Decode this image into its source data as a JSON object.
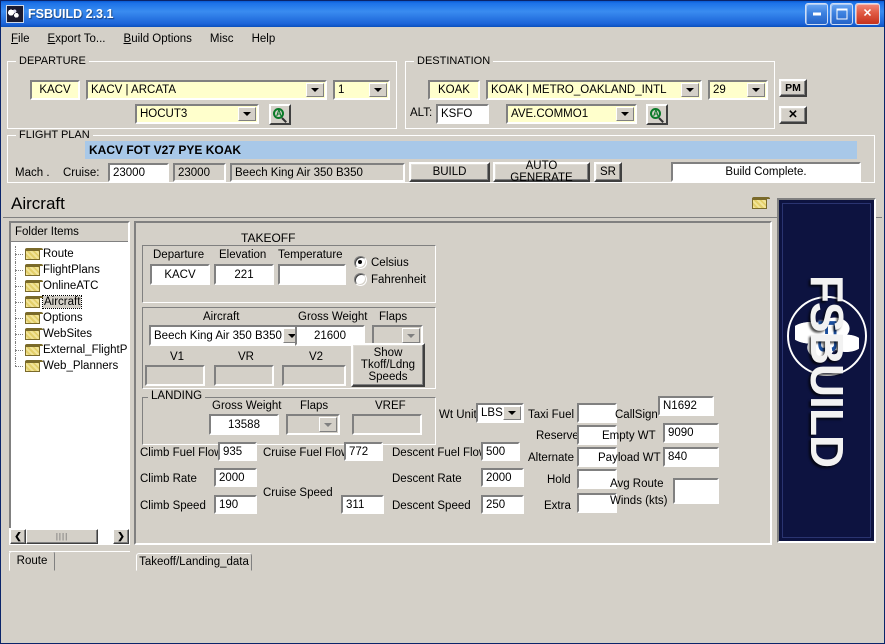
{
  "window": {
    "title": "FSBUILD 2.3.1",
    "icon": "app-icon",
    "buttons": {
      "minimize": "minimize",
      "maximize": "maximize",
      "close": "close"
    }
  },
  "menu": [
    {
      "label": "File",
      "accel": "F"
    },
    {
      "label": "Export To...",
      "accel": "E"
    },
    {
      "label": "Build Options",
      "accel": "B"
    },
    {
      "label": "Misc",
      "accel": ""
    },
    {
      "label": "Help",
      "accel": ""
    }
  ],
  "departure": {
    "legend": "DEPARTURE",
    "icao": "KACV",
    "airport": "KACV | ARCATA",
    "runway": "1",
    "procedure": "HOCUT3",
    "search_icon": "magnifier-icon"
  },
  "destination": {
    "legend": "DESTINATION",
    "icao": "KOAK",
    "airport": "KOAK | METRO_OAKLAND_INTL",
    "runway": "29",
    "alt_label": "ALT:",
    "alt_icao": "KSFO",
    "procedure": "AVE.COMMO1",
    "search_icon": "magnifier-icon",
    "pm_button": "PM",
    "close_button": "✕"
  },
  "flight_plan": {
    "legend": "FLIGHT PLAN",
    "route": "KACV FOT V27 PYE KOAK",
    "mach_label": "Mach .",
    "cruise_label": "Cruise:",
    "cruise_1": "23000",
    "cruise_2": "23000",
    "aircraft": "Beech King Air 350 B350",
    "build_button": "BUILD",
    "auto_generate_button": "AUTO GENERATE",
    "sr_button": "SR",
    "status": "Build Complete."
  },
  "section": {
    "title": "Aircraft",
    "folder_icon": "folder-icon"
  },
  "tree": {
    "header": "Folder Items",
    "close_icon": "close-icon",
    "items": [
      {
        "label": "Route",
        "selected": false
      },
      {
        "label": "FlightPlans",
        "selected": false
      },
      {
        "label": "OnlineATC",
        "selected": false
      },
      {
        "label": "Aircraft",
        "selected": true
      },
      {
        "label": "Options",
        "selected": false
      },
      {
        "label": "WebSites",
        "selected": false
      },
      {
        "label": "External_FlightP",
        "selected": false
      },
      {
        "label": "Web_Planners",
        "selected": false
      }
    ],
    "scroll_left": "❮",
    "scroll_right": "❯",
    "tab": "Route"
  },
  "takeoff": {
    "legend": "TAKEOFF",
    "departure_label": "Departure",
    "departure_value": "KACV",
    "elevation_label": "Elevation",
    "elevation_value": "221",
    "temperature_label": "Temperature",
    "temperature_value": "",
    "celsius_label": "Celsius",
    "fahrenheit_label": "Fahrenheit",
    "temp_unit_selected": "Celsius"
  },
  "aircraft_group": {
    "aircraft_label": "Aircraft",
    "aircraft_value": "Beech King Air 350 B350",
    "gross_weight_label": "Gross Weight",
    "gross_weight_value": "21600",
    "flaps_label": "Flaps",
    "flaps_value": "",
    "v1_label": "V1",
    "v1_value": "",
    "vr_label": "VR",
    "vr_value": "",
    "v2_label": "V2",
    "v2_value": "",
    "show_speeds_button": "Show\nTkoff/Ldng\nSpeeds",
    "show_speeds_line1": "Show",
    "show_speeds_line2": "Tkoff/Ldng",
    "show_speeds_line3": "Speeds"
  },
  "landing": {
    "legend": "LANDING",
    "gross_weight_label": "Gross Weight",
    "gross_weight_value": "13588",
    "flaps_label": "Flaps",
    "flaps_value": "",
    "vref_label": "VREF",
    "vref_value": ""
  },
  "performance": {
    "climb_fuel_flow_label": "Climb Fuel Flow",
    "climb_fuel_flow_value": "935",
    "climb_rate_label": "Climb Rate",
    "climb_rate_value": "2000",
    "climb_speed_label": "Climb Speed",
    "climb_speed_value": "190",
    "cruise_fuel_flow_label": "Cruise Fuel Flow",
    "cruise_fuel_flow_value": "772",
    "cruise_speed_label": "Cruise Speed",
    "cruise_speed_value": "311",
    "descent_fuel_flow_label": "Descent Fuel Flow",
    "descent_fuel_flow_value": "500",
    "descent_rate_label": "Descent Rate",
    "descent_rate_value": "2000",
    "descent_speed_label": "Descent Speed",
    "descent_speed_value": "250"
  },
  "fuel": {
    "wt_unit_label": "Wt Unit",
    "wt_unit_value": "LBS",
    "taxi_fuel_label": "Taxi Fuel",
    "taxi_fuel_value": "",
    "reserve_label": "Reserve",
    "reserve_value": "",
    "alternate_label": "Alternate",
    "alternate_value": "",
    "hold_label": "Hold",
    "hold_value": "",
    "extra_label": "Extra",
    "extra_value": ""
  },
  "weights": {
    "callsign_label": "CallSign",
    "callsign_value": "N1692",
    "empty_wt_label": "Empty WT",
    "empty_wt_value": "9090",
    "payload_wt_label": "Payload WT",
    "payload_wt_value": "840",
    "avg_winds_label_1": "Avg Route",
    "avg_winds_label_2": "Winds (kts)",
    "avg_winds_value": ""
  },
  "bottom_tab": {
    "label": "Takeoff/Landing_data"
  },
  "logo": {
    "word": "FSBUILD",
    "mark": "FS"
  },
  "colors": {
    "titlebar_blue": "#1c72e8",
    "face": "#d4d0c8",
    "field_yellow": "#ffffcc",
    "route_highlight": "#a8c8e8",
    "logo_navy": "#0d1340",
    "logo_accent": "#1b4f9e"
  }
}
